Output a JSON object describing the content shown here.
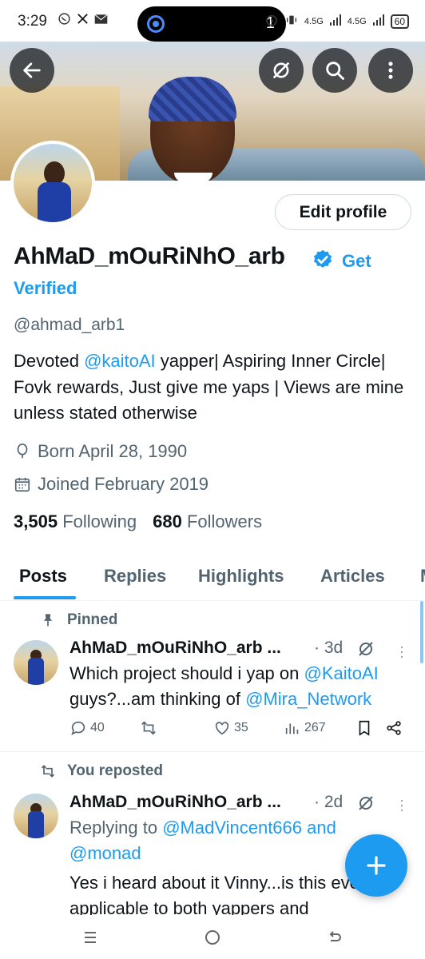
{
  "status_bar": {
    "time": "3:29",
    "left_icons": [
      "whatsapp-icon",
      "x-icon",
      "mail-icon"
    ],
    "island_count": "1",
    "network_1": "4.5G",
    "network_2": "4.5G",
    "battery": "60"
  },
  "header": {
    "back_icon": "arrow-left-icon",
    "grok_icon": "grok-icon",
    "search_icon": "search-icon",
    "more_icon": "more-vertical-icon"
  },
  "profile": {
    "edit_label": "Edit profile",
    "name": "AhMaD_mOuRiNhO_arb",
    "get_verified": "Get Verified",
    "handle": "@ahmad_arb1",
    "bio_part1": "Devoted ",
    "bio_link": "@kaitoAI",
    "bio_part2": " yapper| Aspiring Inner Circle| Fovk rewards, Just give me yaps | Views are mine unless stated otherwise",
    "born": "Born April 28, 1990",
    "joined": "Joined February 2019",
    "following_count": "3,505",
    "following_label": "Following",
    "followers_count": "680",
    "followers_label": "Followers"
  },
  "tabs": [
    {
      "label": "Posts"
    },
    {
      "label": "Replies"
    },
    {
      "label": "Highlights"
    },
    {
      "label": "Articles"
    },
    {
      "label": "M"
    }
  ],
  "posts": [
    {
      "context": "Pinned",
      "name": "AhMaD_mOuRiNhO_arb ...",
      "time": "· 3d",
      "text_part1": "Which project should i yap on ",
      "text_link1": "@KaitoAI",
      "text_part2": " guys?...am thinking of ",
      "text_link2": "@Mira_Network",
      "replies": "40",
      "reposts": "",
      "likes": "35",
      "views": "267"
    },
    {
      "context": "You reposted",
      "name": "AhMaD_mOuRiNhO_arb ...",
      "time": "· 2d",
      "replying_prefix": "Replying to ",
      "replying_link": "@MadVincent666 and @monad",
      "text": "Yes i heard about it Vinny...is this even applicable to both yappers and"
    }
  ],
  "fab_icon": "plus-icon",
  "colors": {
    "accent": "#1d9bf0",
    "text": "#0f1419",
    "secondary": "#536471"
  }
}
